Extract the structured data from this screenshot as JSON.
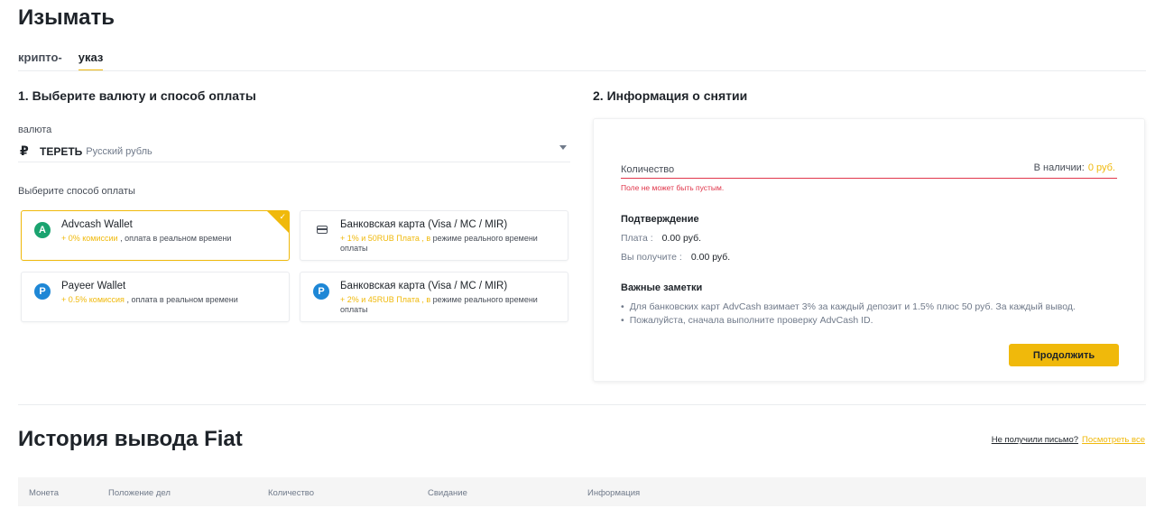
{
  "page": {
    "title": "Изымать"
  },
  "tabs": [
    {
      "label": "крипто-"
    },
    {
      "label": "указ"
    }
  ],
  "left": {
    "section_title": "1. Выберите валюту и способ оплаты",
    "currency_label": "валюта",
    "currency": {
      "symbol": "₽",
      "code": "ТЕРЕТЬ",
      "name": "Русский рубль"
    },
    "payment_label": "Выберите способ оплаты",
    "methods": [
      {
        "title": "Advcash Wallet",
        "fee": "+ 0% комиссии",
        "sep": " , ",
        "desc": "оплата в реальном времени",
        "icon": "advcash-icon",
        "selected": true
      },
      {
        "title": "Банковская карта (Visa / MC / MIR)",
        "fee": "+ 1% и 50RUB Плата , в",
        "sep": " ",
        "desc": "режиме реального времени оплаты",
        "icon": "bank-card-icon",
        "selected": false
      },
      {
        "title": "Payeer Wallet",
        "fee": "+ 0.5% комиссия",
        "sep": " , ",
        "desc": "оплата в реальном времени",
        "icon": "payeer-icon",
        "selected": false
      },
      {
        "title": "Банковская карта (Visa / MC / MIR)",
        "fee": "+ 2% и 45RUB Плата , в",
        "sep": " ",
        "desc": "режиме реального времени оплаты",
        "icon": "payeer-icon",
        "selected": false
      }
    ]
  },
  "right": {
    "section_title": "2. Информация о снятии",
    "amount_placeholder": "Количество",
    "available_label": "В наличии:",
    "available_value": "0  руб.",
    "error": "Поле не может быть пустым.",
    "confirm_title": "Подтверждение",
    "fee_label": "Плата :",
    "fee_value": "0.00 руб.",
    "receive_label": "Вы получите :",
    "receive_value": "0.00 руб.",
    "notes_title": "Важные заметки",
    "notes": [
      "Для банковских карт AdvCash взимает 3% за каждый депозит и 1.5% плюс 50 руб. За каждый вывод.",
      "Пожалуйста, сначала выполните проверку AdvCash ID."
    ],
    "continue_label": "Продолжить"
  },
  "history": {
    "title": "История вывода Fiat",
    "no_email": "Не получили письмо?",
    "view_all": "Посмотреть все",
    "columns": [
      "Монета",
      "Положение дел",
      "Количество",
      "Свидание",
      "Информация"
    ]
  },
  "colors": {
    "accent": "#f0b90b",
    "error": "#e0364b",
    "advcash": "#1aa36f",
    "payeer": "#1e87d6"
  }
}
